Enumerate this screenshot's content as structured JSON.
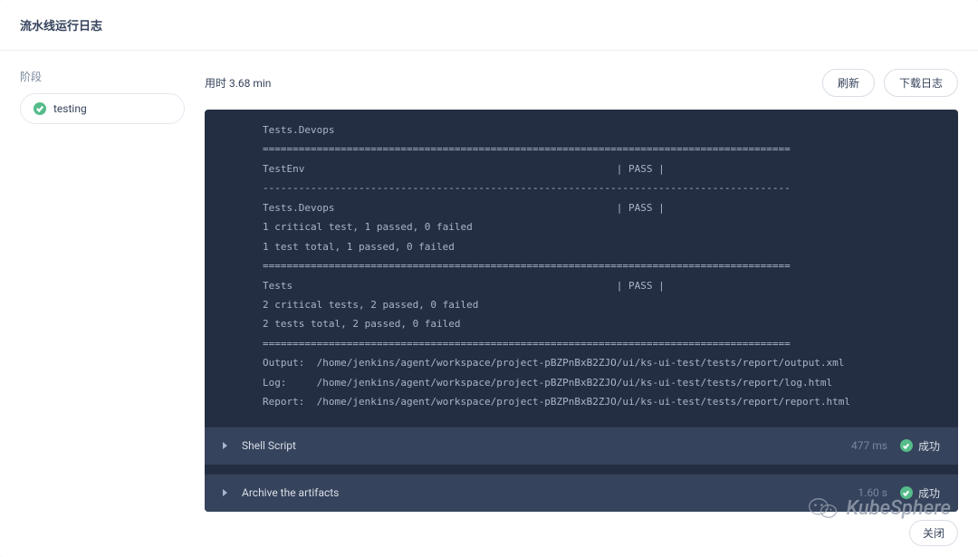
{
  "modal": {
    "title": "流水线运行日志"
  },
  "sidebar": {
    "label": "阶段",
    "stage": {
      "name": "testing"
    }
  },
  "header": {
    "duration_label": "用时 3.68 min",
    "btn_refresh": "刷新",
    "btn_download": "下载日志"
  },
  "log_text": "Tests.Devops\n========================================================================================\nTestEnv                                                    | PASS |\n----------------------------------------------------------------------------------------\nTests.Devops                                               | PASS |\n1 critical test, 1 passed, 0 failed\n1 test total, 1 passed, 0 failed\n========================================================================================\nTests                                                      | PASS |\n2 critical tests, 2 passed, 0 failed\n2 tests total, 2 passed, 0 failed\n========================================================================================\nOutput:  /home/jenkins/agent/workspace/project-pBZPnBxB2ZJO/ui/ks-ui-test/tests/report/output.xml\nLog:     /home/jenkins/agent/workspace/project-pBZPnBxB2ZJO/ui/ks-ui-test/tests/report/log.html\nReport:  /home/jenkins/agent/workspace/project-pBZPnBxB2ZJO/ui/ks-ui-test/tests/report/report.html",
  "steps": [
    {
      "name": "Shell Script",
      "duration": "477 ms",
      "status": "成功"
    },
    {
      "name": "Archive the artifacts",
      "duration": "1.60 s",
      "status": "成功"
    }
  ],
  "watermark": "KubeSphere",
  "footer": {
    "close": "关闭"
  },
  "colors": {
    "success": "#55bc8a",
    "panel": "#242e42",
    "step": "#36435c"
  }
}
